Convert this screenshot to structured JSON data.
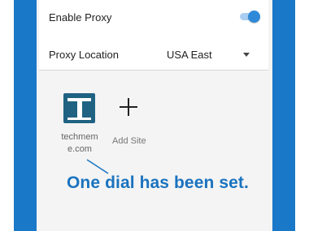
{
  "settings": {
    "enable_proxy_label": "Enable Proxy",
    "enable_proxy_on": true,
    "proxy_location_label": "Proxy Location",
    "proxy_location_value": "USA East"
  },
  "dials": {
    "items": [
      {
        "label": "techmeme.com",
        "display_lines": [
          "techmem",
          "e.com"
        ],
        "icon": "techmeme-logo-icon"
      }
    ],
    "add_label": "Add Site",
    "add_icon": "plus-icon"
  },
  "annotation": "One dial has been set.",
  "colors": {
    "frame": "#1a78c8",
    "toggle_on": "#2f89d8",
    "annotation": "#1a73bf",
    "dial_icon": "#1f6282"
  }
}
